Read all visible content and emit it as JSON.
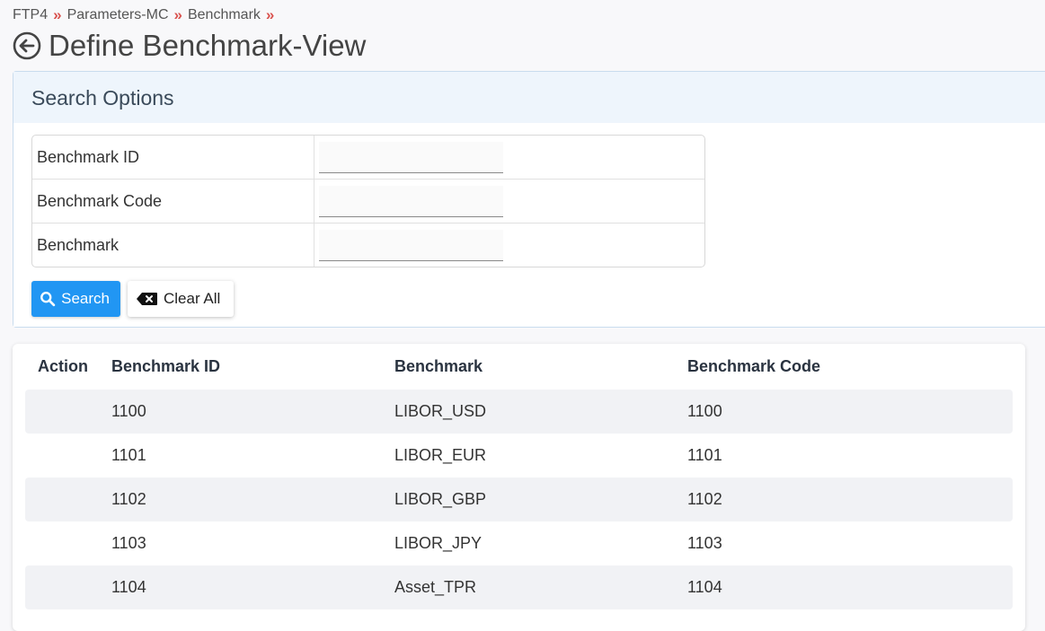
{
  "breadcrumb": [
    "FTP4",
    "Parameters-MC",
    "Benchmark"
  ],
  "breadcrumb_separator": "»",
  "page_title": "Define Benchmark-View",
  "search_panel": {
    "title": "Search Options",
    "fields": [
      {
        "label": "Benchmark ID",
        "value": "",
        "placeholder": ""
      },
      {
        "label": "Benchmark Code",
        "value": "",
        "placeholder": ""
      },
      {
        "label": "Benchmark",
        "value": "",
        "placeholder": ""
      }
    ],
    "search_label": "Search",
    "clear_label": "Clear All"
  },
  "table": {
    "headers": [
      "Action",
      "Benchmark ID",
      "Benchmark",
      "Benchmark Code"
    ],
    "rows": [
      {
        "action": "",
        "id": "1100",
        "benchmark": "LIBOR_USD",
        "code": "1100"
      },
      {
        "action": "",
        "id": "1101",
        "benchmark": "LIBOR_EUR",
        "code": "1101"
      },
      {
        "action": "",
        "id": "1102",
        "benchmark": "LIBOR_GBP",
        "code": "1102"
      },
      {
        "action": "",
        "id": "1103",
        "benchmark": "LIBOR_JPY",
        "code": "1103"
      },
      {
        "action": "",
        "id": "1104",
        "benchmark": "Asset_TPR",
        "code": "1104"
      }
    ]
  },
  "colors": {
    "accent": "#2196f3",
    "separator": "#d9534f",
    "panel_header_bg": "#eef5fc",
    "row_alt_bg": "#f1f2f5"
  },
  "icons": {
    "back": "circle-arrow-left-icon",
    "search": "magnifier-icon",
    "clear": "backspace-x-icon"
  }
}
